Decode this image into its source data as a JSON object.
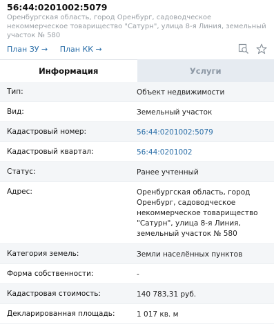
{
  "header": {
    "title": "56:44:0201002:5079",
    "address": "Оренбургская область, город Оренбург, садоводческое некоммерческое товарищество \"Сатурн\", улица 8-я Линия, земельный участок № 580"
  },
  "links": {
    "plan_zu": "План ЗУ →",
    "plan_kk": "План КК →"
  },
  "icons": [
    "search-map-icon",
    "star-icon"
  ],
  "tabs": [
    {
      "label": "Информация",
      "active": true
    },
    {
      "label": "Услуги",
      "active": false
    }
  ],
  "rows": [
    {
      "label": "Тип:",
      "value": "Объект недвижимости",
      "link": false
    },
    {
      "label": "Вид:",
      "value": "Земельный участок",
      "link": false
    },
    {
      "label": "Кадастровый номер:",
      "value": "56:44:0201002:5079",
      "link": true
    },
    {
      "label": "Кадастровый квартал:",
      "value": "56:44:0201002",
      "link": true
    },
    {
      "label": "Статус:",
      "value": "Ранее учтенный",
      "link": false
    },
    {
      "label": "Адрес:",
      "value": "Оренбургская область, город Оренбург, садоводческое некоммерческое товарищество \"Сатурн\", улица 8-я Линия, земельный участок № 580",
      "link": false
    },
    {
      "label": "Категория земель:",
      "value": "Земли населённых пунктов",
      "link": false
    },
    {
      "label": "Форма собственности:",
      "value": "-",
      "link": false
    },
    {
      "label": "Кадастровая стоимость:",
      "value": "140 783,31 руб.",
      "link": false
    },
    {
      "label": "Декларированная площадь:",
      "value": "1 017 кв. м",
      "link": false
    }
  ]
}
